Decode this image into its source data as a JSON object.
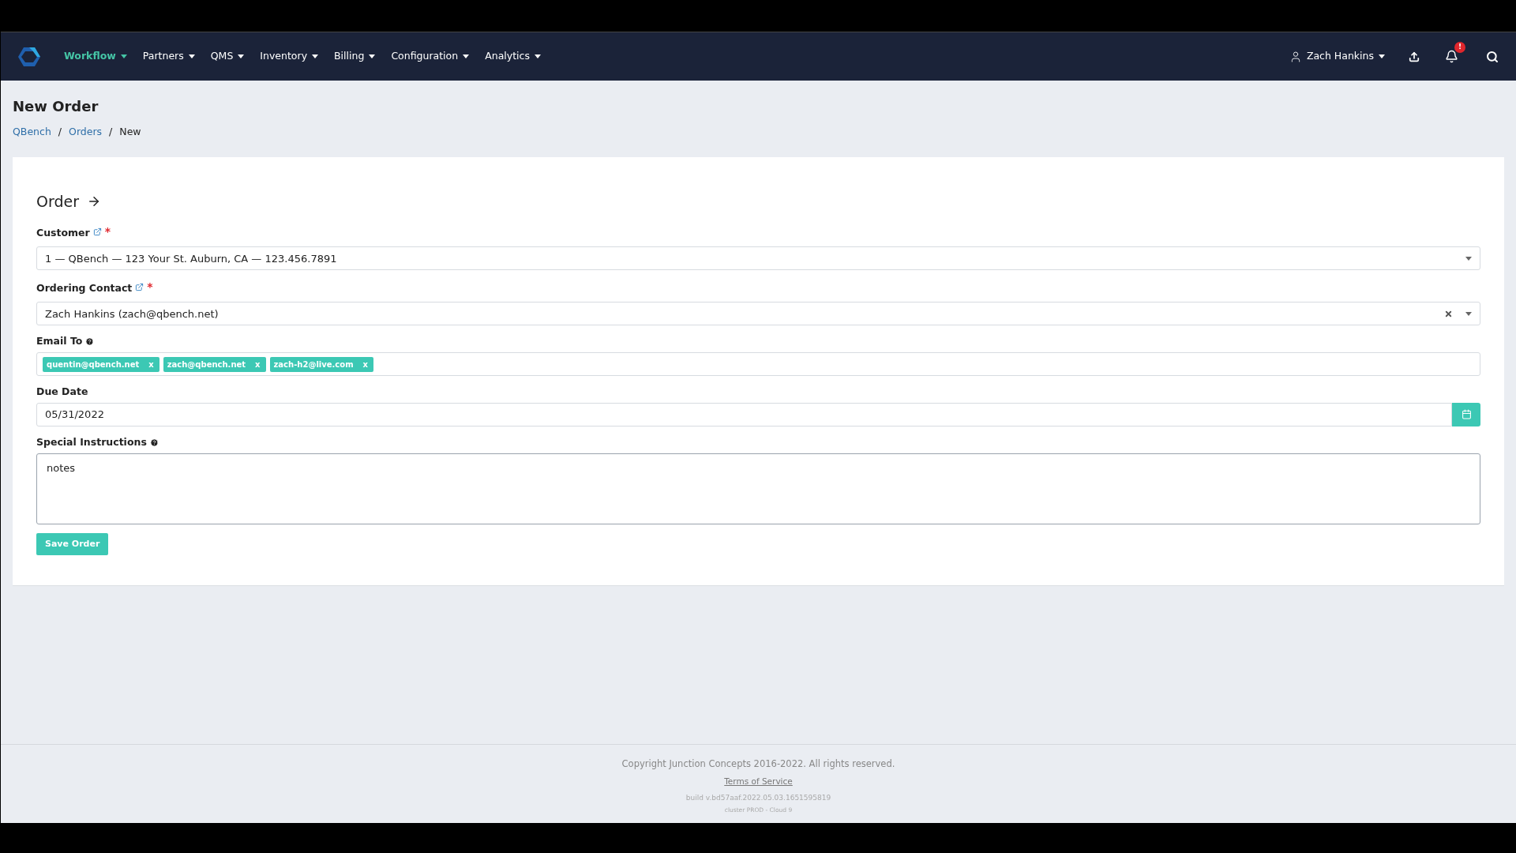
{
  "navbar": {
    "menus": [
      {
        "label": "Workflow",
        "selected": true
      },
      {
        "label": "Partners",
        "selected": false
      },
      {
        "label": "QMS",
        "selected": false
      },
      {
        "label": "Inventory",
        "selected": false
      },
      {
        "label": "Billing",
        "selected": false
      },
      {
        "label": "Configuration",
        "selected": false
      },
      {
        "label": "Analytics",
        "selected": false
      }
    ],
    "user": "Zach Hankins",
    "notification_badge": "!"
  },
  "page": {
    "title": "New Order",
    "breadcrumbs": [
      {
        "label": "QBench",
        "link": true
      },
      {
        "label": "Orders",
        "link": true
      },
      {
        "label": "New",
        "link": false
      }
    ],
    "separator": "/"
  },
  "form": {
    "heading": "Order",
    "fields": [
      {
        "kind": "select",
        "label": "Customer",
        "required_mark": "*",
        "external_link": true,
        "value": "1 — QBench — 123 Your St. Auburn, CA — 123.456.7891"
      },
      {
        "kind": "select",
        "label": "Ordering Contact",
        "required_mark": "*",
        "external_link": true,
        "value": "Zach Hankins (zach@qbench.net)",
        "clearable": true
      },
      {
        "kind": "tags",
        "label": "Email To",
        "help": true,
        "tags": [
          {
            "text": "quentin@qbench.net",
            "remove": "x"
          },
          {
            "text": "zach@qbench.net",
            "remove": "x"
          },
          {
            "text": "zach-h2@live.com",
            "remove": "x"
          }
        ]
      },
      {
        "kind": "date",
        "label": "Due Date",
        "value": "05/31/2022"
      },
      {
        "kind": "textarea",
        "label": "Special Instructions",
        "help": true,
        "value": "notes"
      }
    ],
    "submit": "Save Order"
  },
  "footer": {
    "copyright": "Copyright Junction Concepts 2016-2022. All rights reserved.",
    "terms": "Terms of Service",
    "build": "build v.bd57aaf.2022.05.03.1651595819",
    "cluster": "cluster PROD - Cloud 9"
  }
}
